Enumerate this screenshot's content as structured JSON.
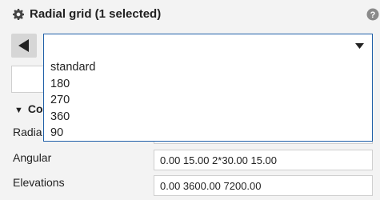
{
  "header": {
    "title": "Radial grid (1 selected)",
    "help_symbol": "?"
  },
  "selector": {
    "value": "",
    "options": [
      "standard",
      "180",
      "270",
      "360",
      "90"
    ]
  },
  "section": {
    "label": "Co"
  },
  "fields": {
    "radial": {
      "label": "Radia",
      "value": ""
    },
    "angular": {
      "label": "Angular",
      "value": "0.00 15.00 2*30.00 15.00"
    },
    "elevations": {
      "label": "Elevations",
      "value": "0.00 3600.00 7200.00"
    }
  }
}
